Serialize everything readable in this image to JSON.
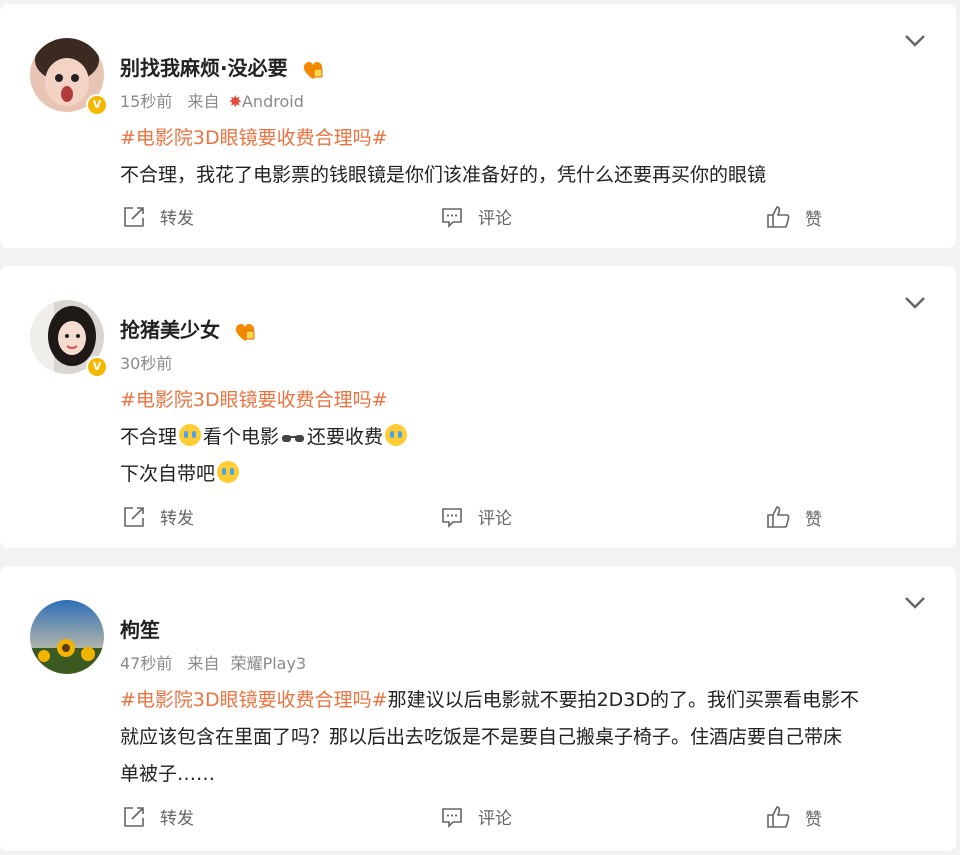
{
  "posts": [
    {
      "username": "别找我麻烦·没必要",
      "time": "15秒前",
      "source_prefix": "来自",
      "source": "Android",
      "hashtag": "#电影院3D眼镜要收费合理吗#",
      "lines": [
        "不合理，我花了电影票的钱眼镜是你们该准备好的，凭什么还要再买你的眼镜"
      ]
    },
    {
      "username": "抢猪美少女",
      "time": "30秒前",
      "hashtag": "#电影院3D眼镜要收费合理吗#",
      "line1a": "不合理",
      "line1b": "看个电影",
      "line1c": "还要收费",
      "line2": "下次自带吧"
    },
    {
      "username": "枸笙",
      "time": "47秒前",
      "source_prefix": "来自",
      "source": "荣耀Play3",
      "hashtag": "#电影院3D眼镜要收费合理吗#",
      "text_after_tag": "那建议以后电影就不要拍2D3D的了。我们买票看电影不",
      "line2": "就应该包含在里面了吗？那以后出去吃饭是不是要自己搬桌子椅子。住酒店要自己带床",
      "line3": "单被子……"
    }
  ],
  "actions": {
    "repost": "转发",
    "comment": "评论",
    "like": "赞"
  },
  "colors": {
    "hashtag": "#eb7340",
    "verified": "#f5b800"
  }
}
